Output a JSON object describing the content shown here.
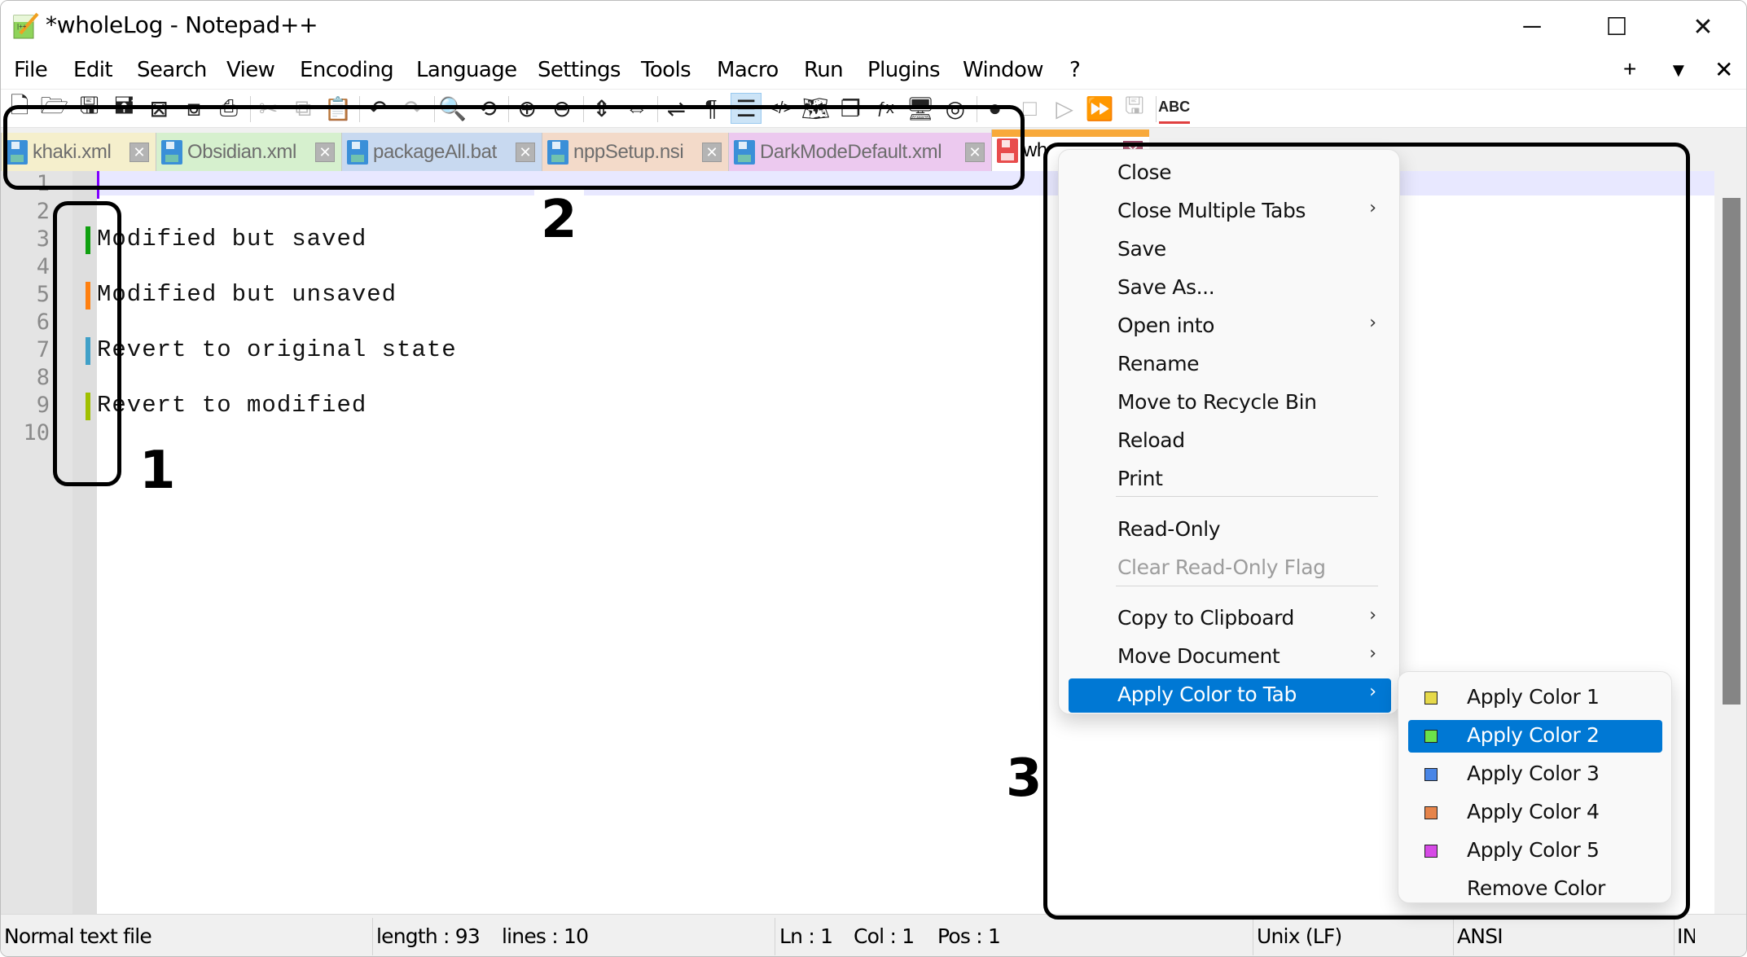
{
  "window": {
    "title": "*wholeLog - Notepad++",
    "controls": {
      "minimize": "─",
      "maximize": "☐",
      "close": "✕"
    }
  },
  "menubar": {
    "items": [
      "File",
      "Edit",
      "Search",
      "View",
      "Encoding",
      "Language",
      "Settings",
      "Tools",
      "Macro",
      "Run",
      "Plugins",
      "Window",
      "?"
    ],
    "right_controls": {
      "new_tab": "+",
      "list_tabs": "▼",
      "close_doc": "✕"
    }
  },
  "toolbar": {
    "icons": [
      {
        "name": "new-file",
        "glyph": "🗋",
        "enabled": true
      },
      {
        "name": "open-file",
        "glyph": "🗁",
        "enabled": true
      },
      {
        "name": "save",
        "glyph": "🖫",
        "enabled": true
      },
      {
        "name": "save-all",
        "glyph": "🖬",
        "enabled": true
      },
      {
        "name": "close",
        "glyph": "⊠",
        "enabled": true
      },
      {
        "name": "close-all",
        "glyph": "⧇",
        "enabled": true
      },
      {
        "name": "print",
        "glyph": "⎙",
        "enabled": true
      },
      {
        "name": "cut",
        "glyph": "✂",
        "enabled": false
      },
      {
        "name": "copy",
        "glyph": "⧉",
        "enabled": false
      },
      {
        "name": "paste",
        "glyph": "📋",
        "enabled": false
      },
      {
        "name": "undo",
        "glyph": "↶",
        "enabled": true
      },
      {
        "name": "redo",
        "glyph": "↷",
        "enabled": false
      },
      {
        "name": "find",
        "glyph": "🔍",
        "enabled": true
      },
      {
        "name": "replace",
        "glyph": "⟲",
        "enabled": true
      },
      {
        "name": "zoom-in",
        "glyph": "⊕",
        "enabled": true
      },
      {
        "name": "zoom-out",
        "glyph": "⊖",
        "enabled": true
      },
      {
        "name": "sync-vertical",
        "glyph": "⇕",
        "enabled": true
      },
      {
        "name": "sync-horizontal",
        "glyph": "⇔",
        "enabled": true
      },
      {
        "name": "word-wrap",
        "glyph": "⇌",
        "enabled": true
      },
      {
        "name": "show-all-chars",
        "glyph": "¶",
        "enabled": true
      },
      {
        "name": "indent-guide",
        "glyph": "☰",
        "enabled": true,
        "active": true
      },
      {
        "name": "xml-tags",
        "glyph": "</>",
        "enabled": true
      },
      {
        "name": "document-map",
        "glyph": "🗺",
        "enabled": true
      },
      {
        "name": "document-list",
        "glyph": "❐",
        "enabled": true
      },
      {
        "name": "function-list",
        "glyph": "ƒx",
        "enabled": true
      },
      {
        "name": "folder-workspace",
        "glyph": "🖥",
        "enabled": true
      },
      {
        "name": "monitoring",
        "glyph": "◎",
        "enabled": true
      },
      {
        "name": "macro-record",
        "glyph": "●",
        "enabled": true
      },
      {
        "name": "macro-stop",
        "glyph": "□",
        "enabled": false
      },
      {
        "name": "macro-play",
        "glyph": "▷",
        "enabled": false
      },
      {
        "name": "macro-run-multiple",
        "glyph": "⏩",
        "enabled": true
      },
      {
        "name": "macro-save",
        "glyph": "🖫",
        "enabled": false
      },
      {
        "name": "spell-check",
        "glyph": "ABC",
        "enabled": true
      }
    ]
  },
  "tabs": [
    {
      "label": "khaki.xml",
      "bg": "#f5efcc",
      "icon_color": "#3a8fd8",
      "active": false
    },
    {
      "label": "Obsidian.xml",
      "bg": "#d6f0ce",
      "icon_color": "#3a8fd8",
      "active": false
    },
    {
      "label": "packageAll.bat",
      "bg": "#c8d9f0",
      "icon_color": "#3a8fd8",
      "active": false
    },
    {
      "label": "nppSetup.nsi",
      "bg": "#f3dac9",
      "icon_color": "#3a8fd8",
      "active": false
    },
    {
      "label": "DarkModeDefault.xml",
      "bg": "#ecc9ef",
      "icon_color": "#3a8fd8",
      "active": false
    },
    {
      "label": "wholeLog",
      "bg": "#ffffff",
      "icon_color": "#e84c4c",
      "active": true
    }
  ],
  "editor": {
    "line_numbers": [
      "1",
      "2",
      "3",
      "4",
      "5",
      "6",
      "7",
      "8",
      "9",
      "10"
    ],
    "lines": [
      "",
      "",
      "Modified but saved",
      "",
      "Modified but unsaved",
      "",
      "Revert to original state",
      "",
      "Revert to modified",
      ""
    ],
    "change_markers": [
      {
        "line": 3,
        "color": "#10a010"
      },
      {
        "line": 5,
        "color": "#ff8010"
      },
      {
        "line": 7,
        "color": "#40a0c8"
      },
      {
        "line": 9,
        "color": "#a0c000"
      }
    ]
  },
  "context_menu": {
    "items": [
      {
        "label": "Close",
        "submenu": false
      },
      {
        "label": "Close Multiple Tabs",
        "submenu": true
      },
      {
        "label": "Save",
        "submenu": false
      },
      {
        "label": "Save As...",
        "submenu": false
      },
      {
        "label": "Open into",
        "submenu": true
      },
      {
        "label": "Rename",
        "submenu": false
      },
      {
        "label": "Move to Recycle Bin",
        "submenu": false
      },
      {
        "label": "Reload",
        "submenu": false
      },
      {
        "label": "Print",
        "submenu": false
      },
      {
        "label": "Read-Only",
        "submenu": false
      },
      {
        "label": "Clear Read-Only Flag",
        "submenu": false,
        "disabled": true
      },
      {
        "label": "Copy to Clipboard",
        "submenu": true
      },
      {
        "label": "Move Document",
        "submenu": true
      },
      {
        "label": "Apply Color to Tab",
        "submenu": true,
        "highlighted": true
      }
    ],
    "arrow_glyph": "›"
  },
  "color_submenu": {
    "items": [
      {
        "label": "Apply Color 1",
        "swatch": "#e6d94a"
      },
      {
        "label": "Apply Color 2",
        "swatch": "#6be24a",
        "highlighted": true
      },
      {
        "label": "Apply Color 3",
        "swatch": "#4a86e6"
      },
      {
        "label": "Apply Color 4",
        "swatch": "#e6844a"
      },
      {
        "label": "Apply Color 5",
        "swatch": "#d64ae6"
      },
      {
        "label": "Remove Color",
        "swatch": null
      }
    ]
  },
  "statusbar": {
    "file_type": "Normal text file",
    "length": "length : 93",
    "lines": "lines : 10",
    "ln": "Ln : 1",
    "col": "Col : 1",
    "pos": "Pos : 1",
    "eol": "Unix (LF)",
    "encoding": "ANSI",
    "mode": "INS"
  },
  "annotations": [
    "1",
    "2",
    "3"
  ],
  "colors": {
    "accent": "#0078d4",
    "active_tab_accent": "#f8a93a",
    "current_line": "#e8e8ff",
    "caret": "#8000ff"
  }
}
